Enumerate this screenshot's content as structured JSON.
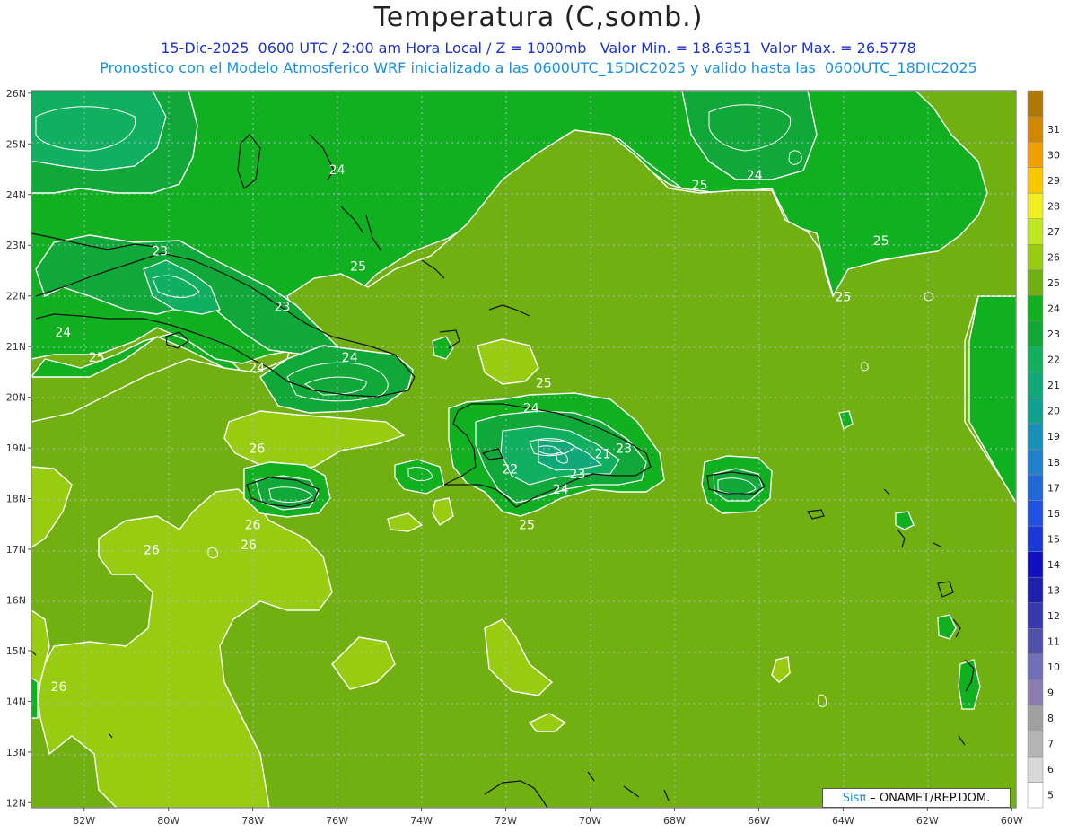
{
  "title": "Temperatura (C,somb.)",
  "subtitle_line1": "15-Dic-2025  0600 UTC / 2:00 am Hora Local / Z = 1000mb   Valor Min. = 18.6351  Valor Max. = 26.5778",
  "subtitle_line2": "Pronostico con el Modelo Atmosferico WRF inicializado a las 0600UTC_15DIC2025 y valido hasta las  0600UTC_18DIC2025",
  "credit_brand": "Sisπ",
  "credit_text": "– ONAMET/REP.DOM.",
  "lon_ticks": [
    "82W",
    "80W",
    "78W",
    "76W",
    "74W",
    "72W",
    "70W",
    "68W",
    "66W",
    "64W",
    "62W",
    "60W"
  ],
  "lat_ticks": [
    "26N",
    "25N",
    "24N",
    "23N",
    "22N",
    "21N",
    "20N",
    "19N",
    "18N",
    "17N",
    "16N",
    "15N",
    "14N",
    "13N",
    "12N"
  ],
  "colorbar": [
    {
      "label": "5",
      "color": "#ffffff"
    },
    {
      "label": "6",
      "color": "#d8d8d8"
    },
    {
      "label": "7",
      "color": "#b4b4b4"
    },
    {
      "label": "8",
      "color": "#a0a0a0"
    },
    {
      "label": "9",
      "color": "#8c7cb0"
    },
    {
      "label": "10",
      "color": "#7070b8"
    },
    {
      "label": "11",
      "color": "#5050a8"
    },
    {
      "label": "12",
      "color": "#3838b0"
    },
    {
      "label": "13",
      "color": "#2020b0"
    },
    {
      "label": "14",
      "color": "#1010c0"
    },
    {
      "label": "15",
      "color": "#1838d8"
    },
    {
      "label": "16",
      "color": "#2050e0"
    },
    {
      "label": "17",
      "color": "#2068d8"
    },
    {
      "label": "18",
      "color": "#2080c8"
    },
    {
      "label": "19",
      "color": "#1890b8"
    },
    {
      "label": "20",
      "color": "#10a090"
    },
    {
      "label": "21",
      "color": "#10a878"
    },
    {
      "label": "22",
      "color": "#10b060"
    },
    {
      "label": "23",
      "color": "#10a838"
    },
    {
      "label": "24",
      "color": "#10b020"
    },
    {
      "label": "25",
      "color": "#70b010"
    },
    {
      "label": "26",
      "color": "#98cc10"
    },
    {
      "label": "27",
      "color": "#c0e820"
    },
    {
      "label": "28",
      "color": "#f0f020"
    },
    {
      "label": "29",
      "color": "#f8c800"
    },
    {
      "label": "30",
      "color": "#f0a000"
    },
    {
      "label": "31",
      "color": "#d08800"
    },
    {
      "label": "",
      "color": "#b07800"
    }
  ],
  "contour_labels": [
    {
      "text": "24",
      "lon": -76.0,
      "lat": 24.4
    },
    {
      "text": "25",
      "lon": -75.5,
      "lat": 22.5
    },
    {
      "text": "23",
      "lon": -80.2,
      "lat": 22.8
    },
    {
      "text": "23",
      "lon": -77.3,
      "lat": 21.7
    },
    {
      "text": "24",
      "lon": -82.5,
      "lat": 21.2
    },
    {
      "text": "25",
      "lon": -81.7,
      "lat": 20.7
    },
    {
      "text": "24",
      "lon": -77.9,
      "lat": 20.5
    },
    {
      "text": "24",
      "lon": -75.7,
      "lat": 20.7
    },
    {
      "text": "25",
      "lon": -71.1,
      "lat": 20.2
    },
    {
      "text": "24",
      "lon": -71.4,
      "lat": 19.7
    },
    {
      "text": "26",
      "lon": -77.9,
      "lat": 18.9
    },
    {
      "text": "22",
      "lon": -71.9,
      "lat": 18.5
    },
    {
      "text": "21",
      "lon": -69.7,
      "lat": 18.8
    },
    {
      "text": "23",
      "lon": -69.2,
      "lat": 18.9
    },
    {
      "text": "23",
      "lon": -70.3,
      "lat": 18.4
    },
    {
      "text": "24",
      "lon": -70.7,
      "lat": 18.1
    },
    {
      "text": "25",
      "lon": -71.5,
      "lat": 17.4
    },
    {
      "text": "26",
      "lon": -78.0,
      "lat": 17.4
    },
    {
      "text": "26",
      "lon": -78.1,
      "lat": 17.0
    },
    {
      "text": "26",
      "lon": -80.4,
      "lat": 16.9
    },
    {
      "text": "26",
      "lon": -82.6,
      "lat": 14.2
    },
    {
      "text": "25",
      "lon": -67.4,
      "lat": 24.1
    },
    {
      "text": "24",
      "lon": -66.1,
      "lat": 24.3
    },
    {
      "text": "25",
      "lon": -63.1,
      "lat": 23.0
    },
    {
      "text": "25",
      "lon": -64.0,
      "lat": 21.9
    }
  ]
}
